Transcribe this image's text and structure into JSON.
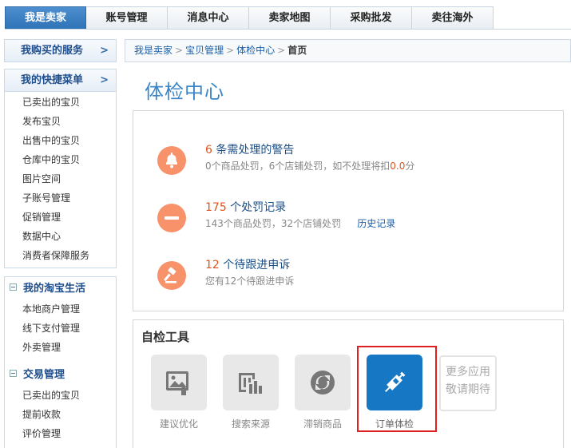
{
  "tabs": [
    "我是卖家",
    "账号管理",
    "消息中心",
    "卖家地图",
    "采购批发",
    "卖往海外"
  ],
  "sidebar": {
    "services": {
      "label": "我购买的服务",
      "arrow": ">"
    },
    "shortcuts": {
      "label": "我的快捷菜单",
      "arrow": ">",
      "items": [
        "已卖出的宝贝",
        "发布宝贝",
        "出售中的宝贝",
        "仓库中的宝贝",
        "图片空间",
        "子账号管理",
        "促销管理",
        "数据中心",
        "消费者保障服务"
      ]
    },
    "life": {
      "label": "我的淘宝生活",
      "items": [
        "本地商户管理",
        "线下支付管理",
        "外卖管理"
      ]
    },
    "trade": {
      "label": "交易管理",
      "items": [
        "已卖出的宝贝",
        "提前收款",
        "评价管理"
      ]
    }
  },
  "breadcrumb": {
    "items": [
      "我是卖家",
      "宝贝管理",
      "体检中心"
    ],
    "sep": ">",
    "current": "首页"
  },
  "page_title": "体检中心",
  "alerts": [
    {
      "num": "6",
      "title": " 条需处理的警告",
      "sub_a": "0个商品处罚，6个店铺处罚，如不处理将扣",
      "sub_red": "0.0",
      "sub_b": "分",
      "icon": "bell-icon"
    },
    {
      "num": "175",
      "title": " 个处罚记录",
      "sub_a": "143个商品处罚，32个店铺处罚",
      "link": "历史记录",
      "icon": "minus-circle-icon"
    },
    {
      "num": "12",
      "title": " 个待跟进申诉",
      "sub_a": "您有12个待跟进申诉",
      "icon": "gavel-icon"
    }
  ],
  "tools": {
    "title": "自检工具",
    "items": [
      {
        "label": "建议优化",
        "icon": "image-upload-icon"
      },
      {
        "label": "搜索来源",
        "icon": "chart-building-icon"
      },
      {
        "label": "滞销商品",
        "icon": "refresh-circle-icon"
      },
      {
        "label": "订单体检",
        "icon": "syringe-icon"
      }
    ],
    "more": {
      "line1": "更多应用",
      "line2": "敬请期待"
    }
  },
  "colors": {
    "accent": "#3a86c8",
    "alert_icon": "#f7926a",
    "highlight": "#e02020",
    "tool_active": "#1677c5"
  }
}
